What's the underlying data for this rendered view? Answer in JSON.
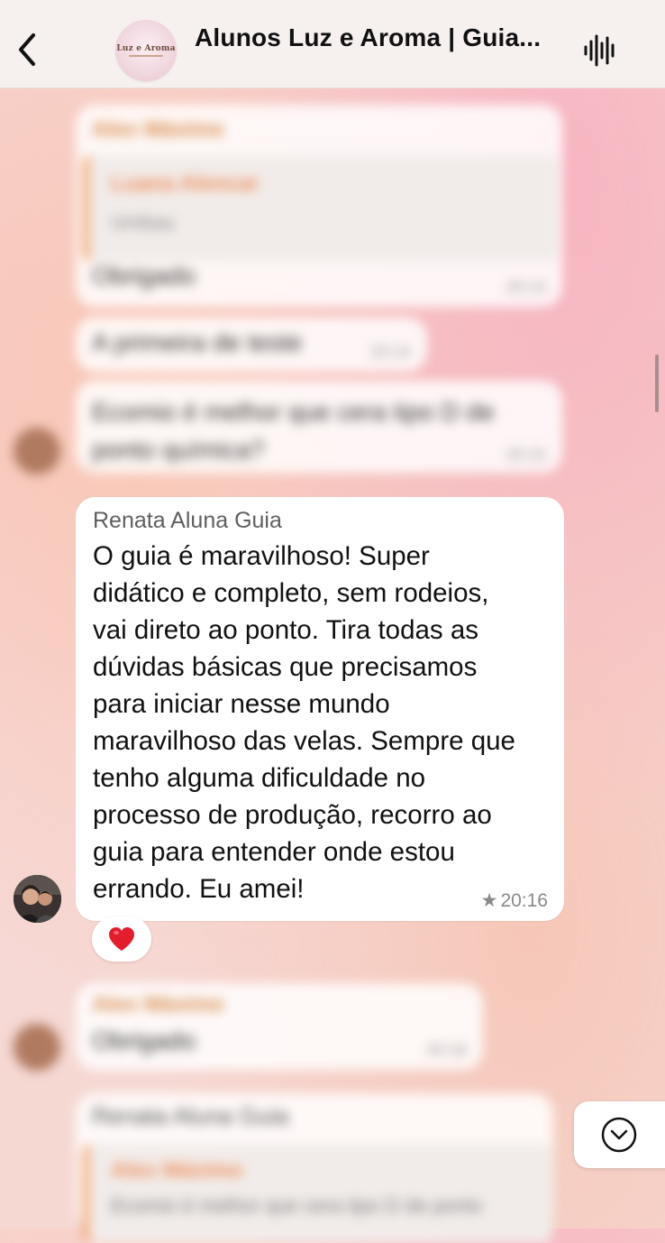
{
  "header": {
    "title": "Alunos Luz e Aroma | Guia...",
    "group_logo_text": "Luz e Aroma",
    "back_icon": "chevron-left-icon",
    "audio_icon": "audio-waveform-icon"
  },
  "main_message": {
    "sender": "Renata Aluna Guia",
    "text": "O guia é maravilhoso! Super\ndidático e completo, sem rodeios,\nvai direto ao ponto. Tira todas as\ndúvidas básicas que precisamos\npara iniciar nesse mundo\nmaravilhoso das velas. Sempre que\ntenho alguma dificuldade no\nprocesso de produção, recorro ao\nguia para entender onde estou\nerrando. Eu amei!",
    "time": "20:16",
    "starred_icon": "star-icon",
    "reaction": "❤️"
  },
  "blurred_messages": [
    {
      "name": "Alex Máximo",
      "quote_name": "Luana Alencar",
      "quote_text": "Umbau",
      "text": "Obrigado",
      "time": "20:14"
    },
    {
      "text": "A primeira de teste",
      "time": "20:14"
    },
    {
      "text": "Ecomio é melhor que cera tipo D de ponto química?",
      "time": "20:15"
    },
    {
      "name": "Alex Máximo",
      "text": "Obrigado",
      "time": "20:18"
    },
    {
      "name": "Renata Aluna Guia",
      "quote_name": "Alex Máximo",
      "quote_text": "Ecomio é melhor que cera tipo D de ponto"
    }
  ],
  "scroll_button": {
    "icon": "chevron-down-circle-icon"
  },
  "colors": {
    "header_bg": "#f6f0ef",
    "bubble_bg": "#ffffff",
    "quote_accent": "#f2a46f",
    "name_accent": "#d68a4b"
  }
}
